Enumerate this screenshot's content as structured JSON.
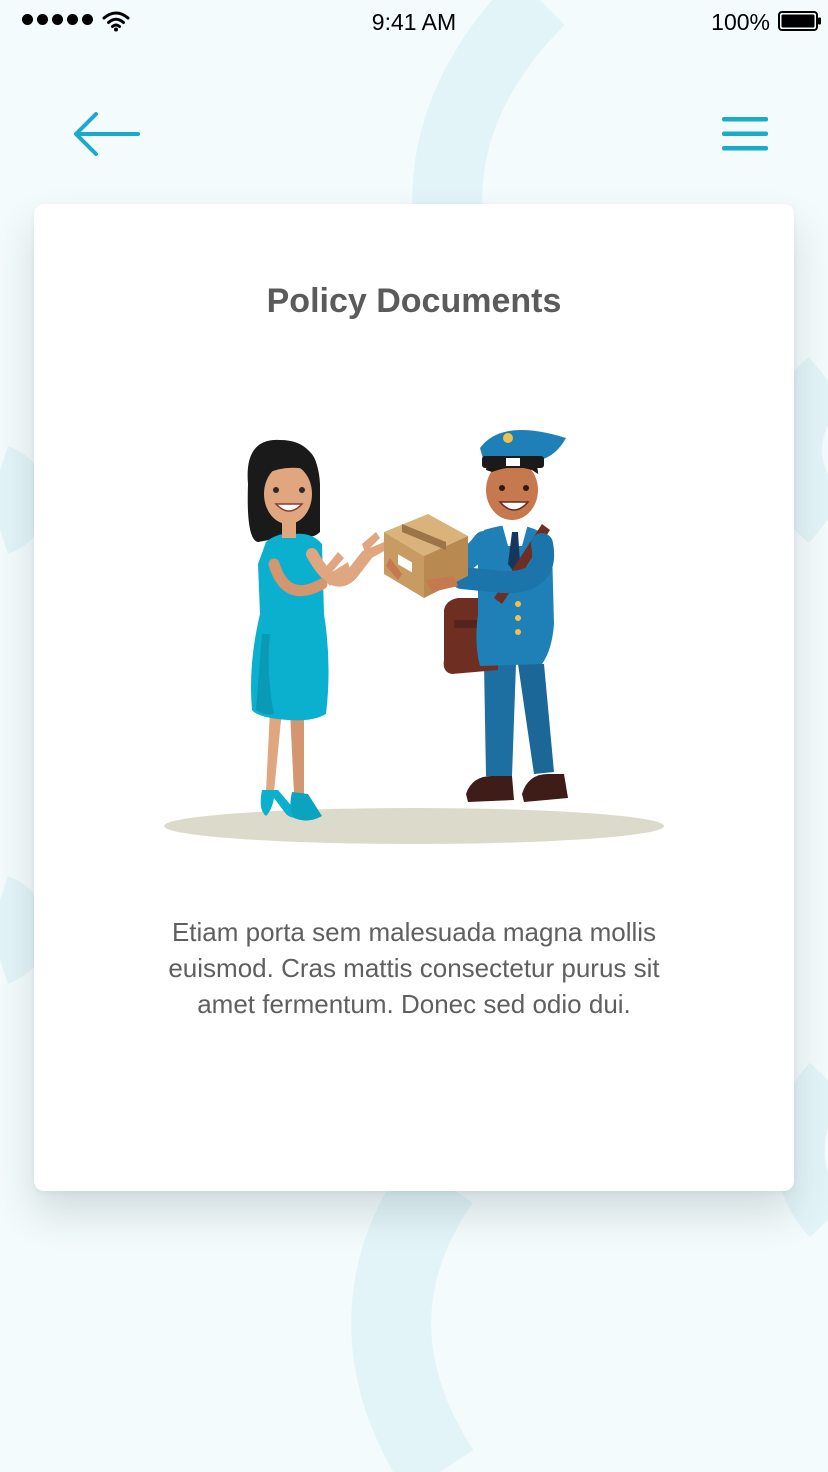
{
  "status_bar": {
    "time": "9:41 AM",
    "battery_percent": "100%",
    "signal_icon": "signal-dots-icon",
    "wifi_icon": "wifi-icon",
    "battery_icon": "battery-icon"
  },
  "nav": {
    "back_icon": "arrow-left-icon",
    "menu_icon": "hamburger-menu-icon"
  },
  "card": {
    "title": "Policy Documents",
    "illustration": "woman-receiving-package-from-courier",
    "description": "Etiam porta sem malesuada magna mollis euismod. Cras mattis consectetur purus sit amet fermentum. Donec sed odio dui."
  },
  "colors": {
    "accent": "#1aabc9",
    "background": "#f3fbfc",
    "card": "#ffffff",
    "title_text": "#5b5b5b",
    "body_text": "#5f5f5f"
  }
}
